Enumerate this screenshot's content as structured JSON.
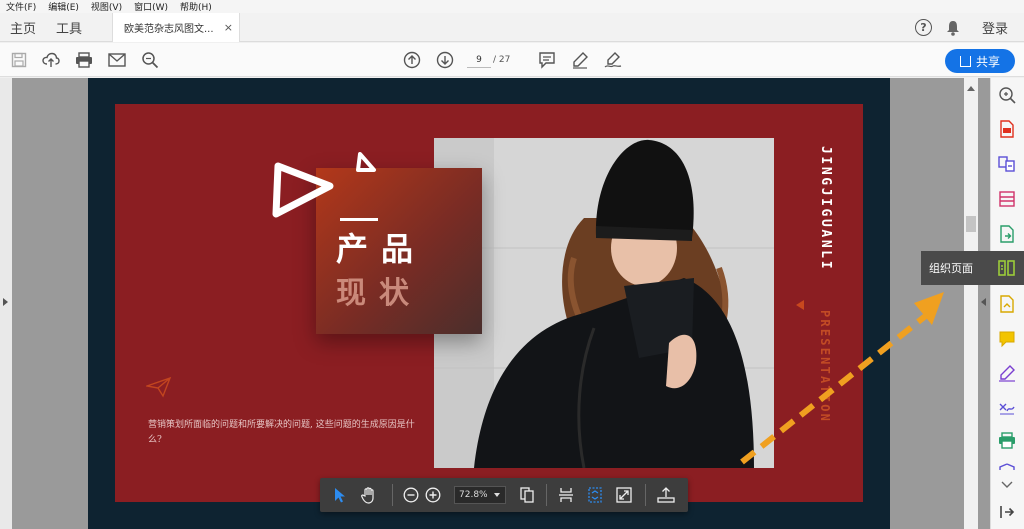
{
  "menubar": {
    "items": [
      "文件(F)",
      "编辑(E)",
      "视图(V)",
      "窗口(W)",
      "帮助(H)"
    ]
  },
  "tabs": {
    "home": "主页",
    "tools": "工具",
    "document": "欧美范杂志风图文...",
    "close": "×"
  },
  "header_right": {
    "help": "?",
    "login": "登录"
  },
  "toolbar": {
    "page_current": "9",
    "page_total": "/ 27",
    "share_label": "共享"
  },
  "slide": {
    "title_line1": "产品",
    "title_line2": "现状",
    "vertical_text_1": "JINGJIGUANLI",
    "vertical_text_2": "PRESENTATION",
    "body_text": "营销策划所面临的问题和所要解决的问题, 这些问题的生成原因是什么?"
  },
  "float_toolbar": {
    "zoom_value": "72.8%"
  },
  "right_rail": {
    "tooltip_label": "组织页面"
  },
  "colors": {
    "accent": "#1473e6",
    "slide_red": "#8b1e22",
    "page_navy": "#0e2331",
    "arrow_orange": "#f0a020"
  }
}
